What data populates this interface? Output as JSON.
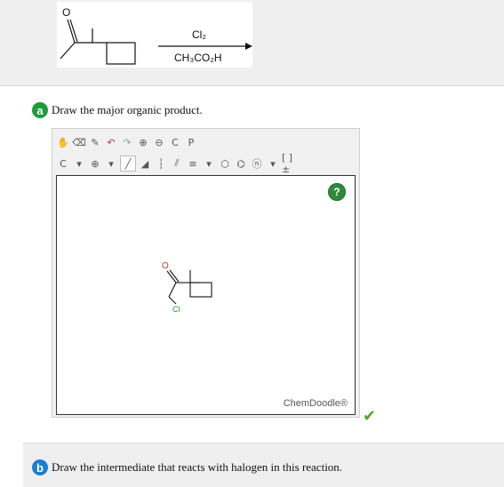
{
  "reaction": {
    "reagent_top": "Cl₂",
    "reagent_bottom": "CH₃CO₂H",
    "reactant_label": "O"
  },
  "part_a": {
    "badge": "a",
    "prompt": "Draw the major organic product."
  },
  "toolbar_row1": {
    "items": [
      "hand-icon",
      "eraser-icon",
      "pencil-icon",
      "undo-icon",
      "redo-icon",
      "zoom-in-icon",
      "zoom-out-icon",
      "copy-button",
      "paste-button"
    ],
    "copy_label": "C",
    "paste_label": "P"
  },
  "toolbar_row2": {
    "element_label": "C",
    "charge_label": "⊕",
    "bracket_label": "[ ]±"
  },
  "canvas": {
    "product_atom_O": "O",
    "product_atom_Cl": "Cl",
    "help_label": "?",
    "brand": "ChemDoodle®"
  },
  "status": {
    "check": "✔",
    "color": "#55a62a"
  },
  "part_b": {
    "badge": "b",
    "prompt": "Draw the intermediate that reacts with halogen in this reaction."
  }
}
